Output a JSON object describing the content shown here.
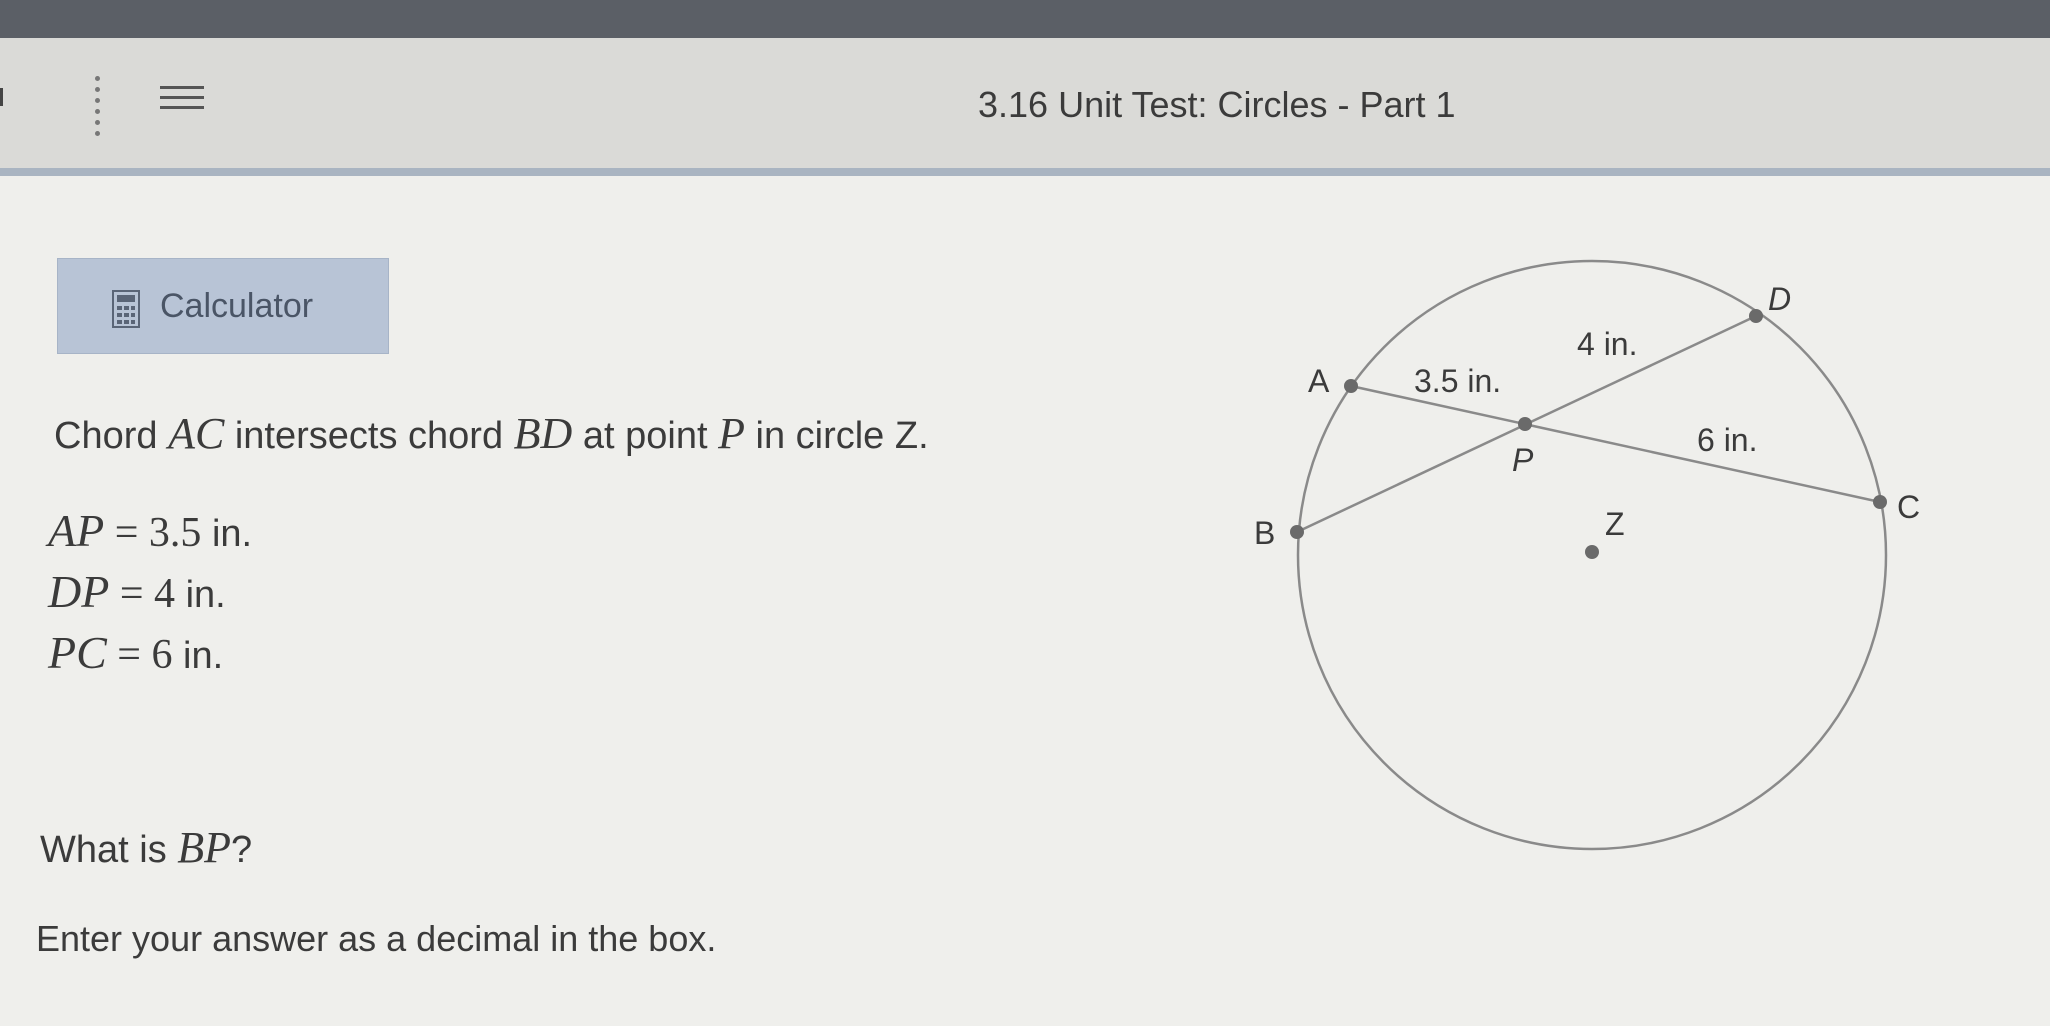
{
  "header": {
    "title": "3.16 Unit Test: Circles - Part 1"
  },
  "toolbar": {
    "calculator_label": "Calculator",
    "calculator_icon": "calculator-icon",
    "menu_icon": "hamburger-menu-icon",
    "more_icon": "vertical-dots-icon"
  },
  "problem": {
    "intro": {
      "prefix": "Chord ",
      "chord1": "AC",
      "middle": " intersects chord ",
      "chord2": "BD",
      "at": " at point ",
      "point": "P",
      "suffix": " in circle Z."
    },
    "givens": [
      {
        "var": "AP",
        "equals": " = ",
        "value": "3.5",
        "unit": " in."
      },
      {
        "var": "DP",
        "equals": " = ",
        "value": "4",
        "unit": " in."
      },
      {
        "var": "PC",
        "equals": " = ",
        "value": "6",
        "unit": " in."
      }
    ],
    "question": {
      "prefix": "What is ",
      "var": "BP",
      "suffix": "?"
    },
    "instruction": "Enter your answer as a decimal in the box."
  },
  "diagram": {
    "point_labels": {
      "A": "A",
      "B": "B",
      "C": "C",
      "D": "D",
      "P": "P",
      "Z": "Z"
    },
    "segment_labels": {
      "AP": "3.5 in.",
      "DP": "4 in.",
      "PC": "6 in."
    }
  }
}
